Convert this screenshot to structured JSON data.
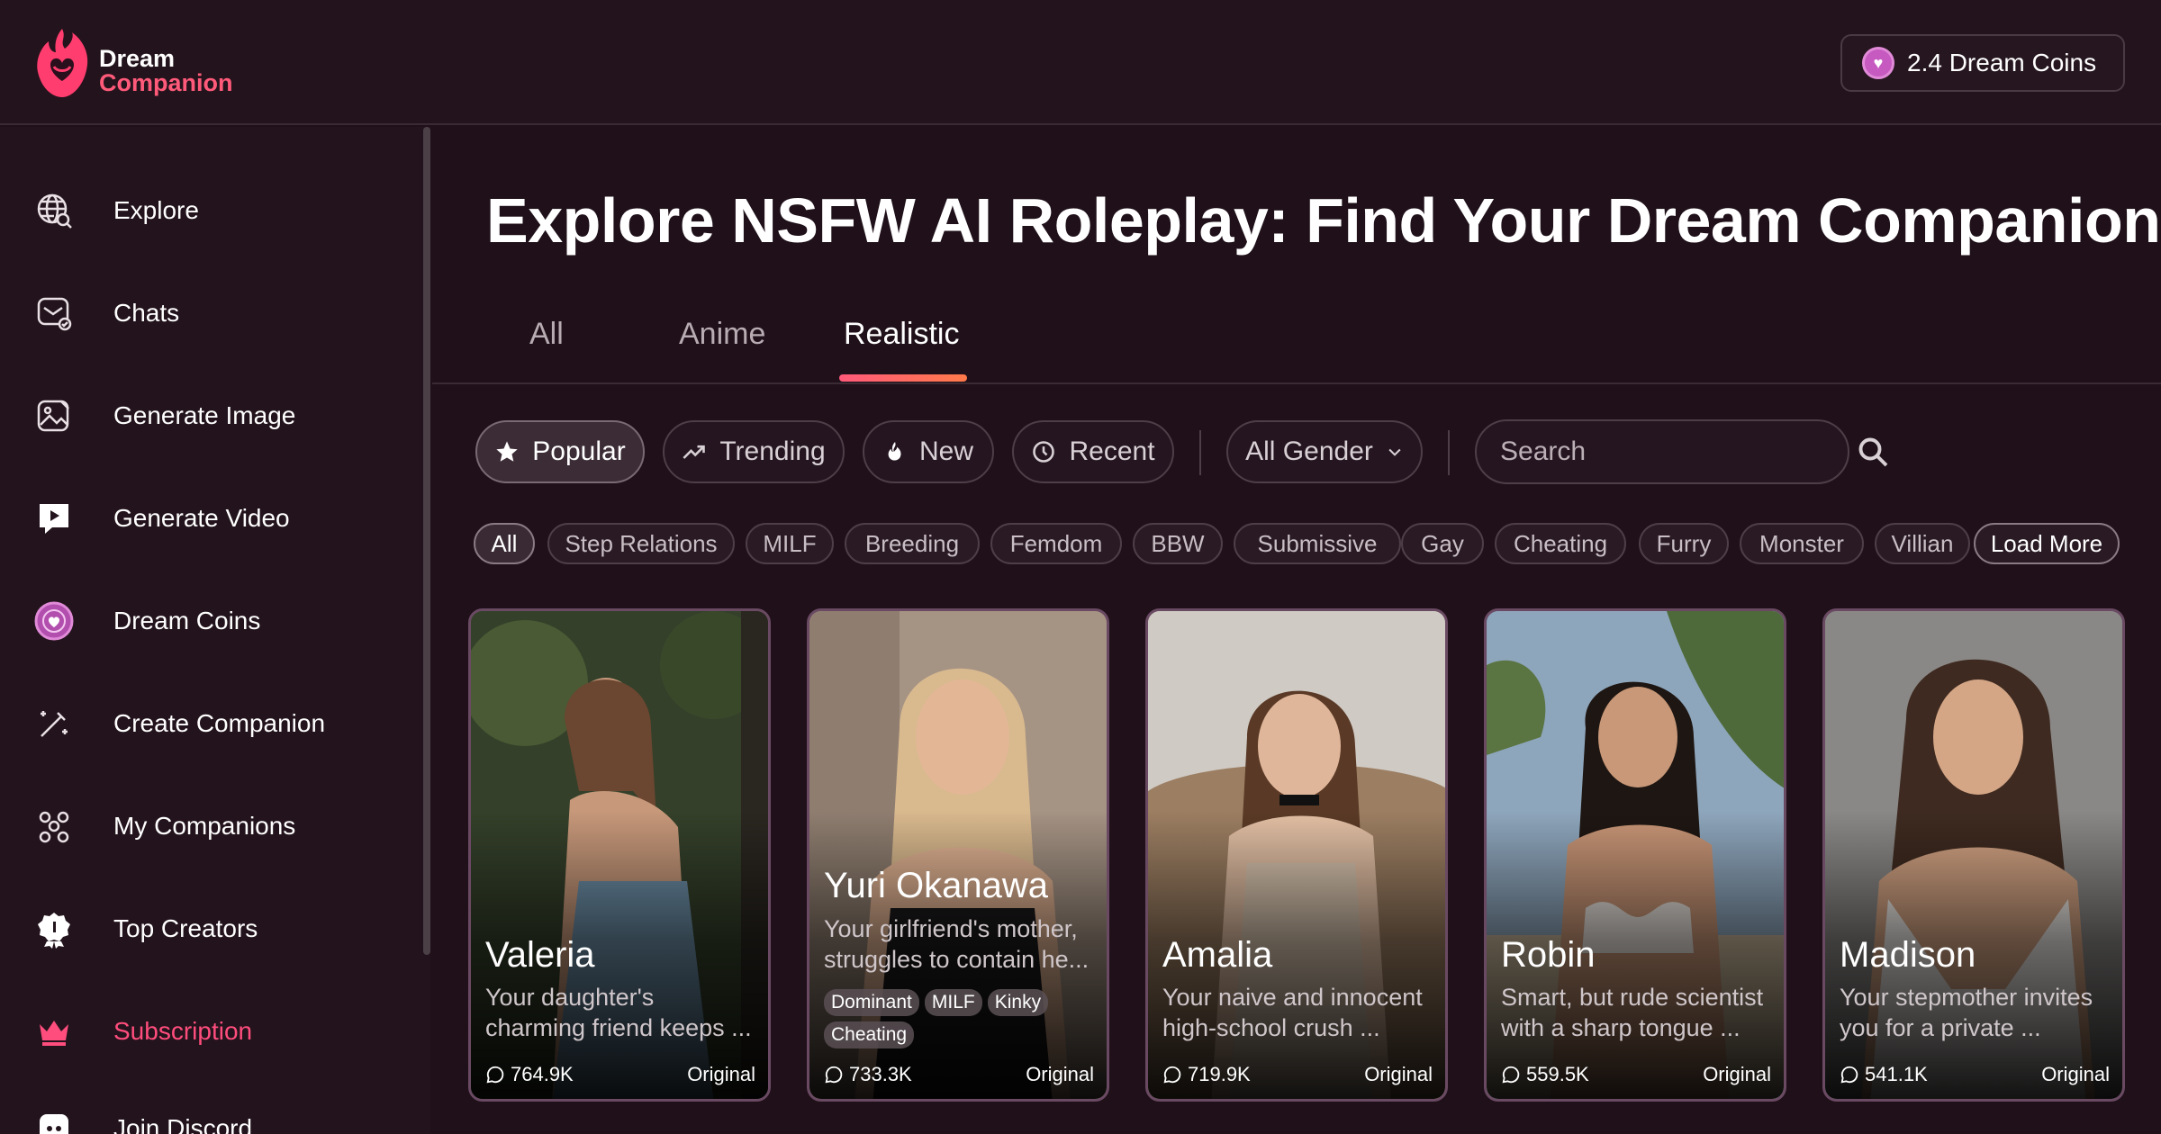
{
  "brand": {
    "line1": "Dream",
    "line2": "Companion"
  },
  "header": {
    "coins_label": "2.4  Dream Coins"
  },
  "sidebar": {
    "items": [
      {
        "label": "Explore",
        "icon": "globe-search-icon"
      },
      {
        "label": "Chats",
        "icon": "chat-icon"
      },
      {
        "label": "Generate Image",
        "icon": "image-edit-icon"
      },
      {
        "label": "Generate Video",
        "icon": "video-chat-icon"
      },
      {
        "label": "Dream Coins",
        "icon": "coin-icon"
      },
      {
        "label": "Create Companion",
        "icon": "magic-wand-icon"
      },
      {
        "label": "My Companions",
        "icon": "people-icon"
      },
      {
        "label": "Top Creators",
        "icon": "award-icon"
      },
      {
        "label": "Subscription",
        "icon": "crown-icon",
        "accent": "#ff4d7d"
      },
      {
        "label": "Join Discord",
        "icon": "discord-icon"
      }
    ]
  },
  "main": {
    "title": "Explore NSFW AI Roleplay: Find Your Dream Companion",
    "tabs": [
      "All",
      "Anime",
      "Realistic"
    ],
    "active_tab": "Realistic",
    "sort": [
      "Popular",
      "Trending",
      "New",
      "Recent"
    ],
    "active_sort": "Popular",
    "gender_select": "All Gender",
    "search_placeholder": "Search",
    "tags": [
      "All",
      "Step Relations",
      "MILF",
      "Breeding",
      "Femdom",
      "BBW",
      "Submissive",
      "Gay",
      "Cheating",
      "Furry",
      "Monster",
      "Villian"
    ],
    "load_more": "Load More",
    "cards": [
      {
        "name": "Valeria",
        "desc": "Your daughter's charming friend keeps ...",
        "count": "764.9K",
        "badge": "Original",
        "tags": []
      },
      {
        "name": "Yuri Okanawa",
        "desc": "Your girlfriend's mother, struggles to contain he...",
        "count": "733.3K",
        "badge": "Original",
        "tags": [
          "Dominant",
          "MILF",
          "Kinky",
          "Cheating"
        ]
      },
      {
        "name": "Amalia",
        "desc": "Your naive and innocent high-school crush ...",
        "count": "719.9K",
        "badge": "Original",
        "tags": []
      },
      {
        "name": "Robin",
        "desc": "Smart, but rude scientist with a sharp tongue ...",
        "count": "559.5K",
        "badge": "Original",
        "tags": []
      },
      {
        "name": "Madison",
        "desc": "Your stepmother invites you for a private ...",
        "count": "541.1K",
        "badge": "Original",
        "tags": []
      }
    ]
  },
  "colors": {
    "accent": "#ff5a7a",
    "background": "#1f1019",
    "panel": "#23131c"
  }
}
